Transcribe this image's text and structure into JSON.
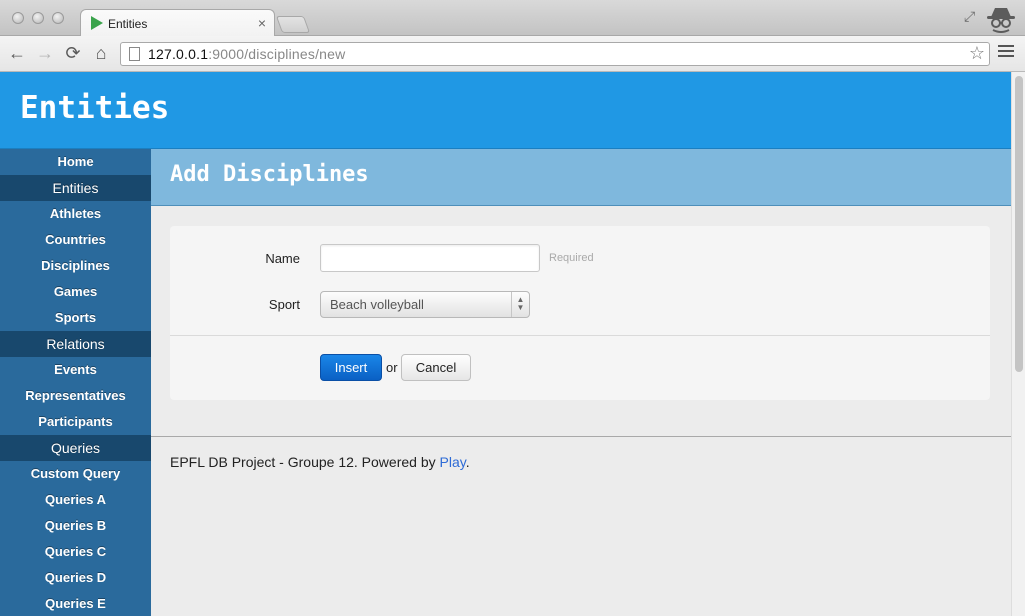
{
  "browser": {
    "tab_title": "Entities",
    "tab_close": "×",
    "url_host": "127.0.0.1",
    "url_path": ":9000/disciplines/new",
    "back_glyph": "←",
    "forward_glyph": "→",
    "reload_glyph": "⟳",
    "home_glyph": "⌂",
    "star_glyph": "☆",
    "fullscreen_glyph": "⤢",
    "icons": [
      "back-arrow-icon",
      "forward-arrow-icon",
      "reload-icon",
      "home-icon",
      "page-icon",
      "bookmark-star-icon",
      "menu-icon",
      "incognito-icon",
      "favicon-play-icon",
      "fullscreen-icon"
    ]
  },
  "site": {
    "title": "Entities"
  },
  "sidebar": {
    "items": [
      {
        "label": "Home"
      },
      {
        "label": "Entities"
      },
      {
        "label": "Athletes"
      },
      {
        "label": "Countries"
      },
      {
        "label": "Disciplines"
      },
      {
        "label": "Games"
      },
      {
        "label": "Sports"
      },
      {
        "label": "Relations"
      },
      {
        "label": "Events"
      },
      {
        "label": "Representatives"
      },
      {
        "label": "Participants"
      },
      {
        "label": "Queries"
      },
      {
        "label": "Custom Query"
      },
      {
        "label": "Queries A"
      },
      {
        "label": "Queries B"
      },
      {
        "label": "Queries C"
      },
      {
        "label": "Queries D"
      },
      {
        "label": "Queries E"
      }
    ]
  },
  "main": {
    "section_title": "Add Disciplines",
    "form": {
      "name_label": "Name",
      "name_value": "",
      "name_help": "Required",
      "sport_label": "Sport",
      "sport_value": "Beach volleyball",
      "insert_label": "Insert",
      "or_text": "or",
      "cancel_label": "Cancel"
    }
  },
  "footer": {
    "text": "EPFL DB Project - Groupe 12. Powered by ",
    "link_text": "Play",
    "trail": "."
  },
  "colors": {
    "header_blue": "#2098e4",
    "section_blue": "#7fb8dd",
    "sidebar_blue": "#2a6a9c",
    "sidebar_section": "#18486d",
    "button_blue": "#0a60c4",
    "link_blue": "#2e6bd6"
  }
}
